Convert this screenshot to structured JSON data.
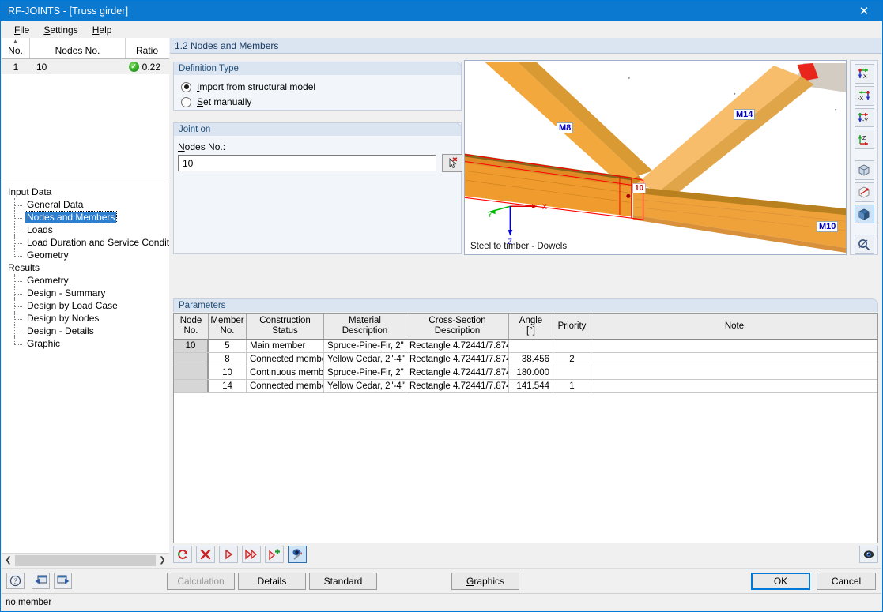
{
  "window": {
    "title": "RF-JOINTS - [Truss girder]",
    "close_icon": "close-icon"
  },
  "menu": {
    "items": [
      {
        "label": "File",
        "accel": "F"
      },
      {
        "label": "Settings",
        "accel": "S"
      },
      {
        "label": "Help",
        "accel": "H"
      }
    ]
  },
  "nodes_list": {
    "columns": [
      "No.",
      "Nodes No.",
      "Ratio"
    ],
    "rows": [
      {
        "no": "1",
        "nodes_no": "10",
        "ratio": "0.22",
        "status_icon": "check-circle-icon"
      }
    ]
  },
  "navigator": {
    "sections": [
      {
        "label": "Input Data",
        "items": [
          {
            "label": "General Data",
            "selected": false
          },
          {
            "label": "Nodes and Members",
            "selected": true
          },
          {
            "label": "Loads",
            "selected": false
          },
          {
            "label": "Load Duration and Service Conditions",
            "selected": false
          },
          {
            "label": "Geometry",
            "selected": false
          }
        ]
      },
      {
        "label": "Results",
        "items": [
          {
            "label": "Geometry",
            "selected": false
          },
          {
            "label": "Design - Summary",
            "selected": false
          },
          {
            "label": "Design by Load Case",
            "selected": false
          },
          {
            "label": "Design by Nodes",
            "selected": false
          },
          {
            "label": "Design - Details",
            "selected": false
          },
          {
            "label": "Graphic",
            "selected": false
          }
        ]
      }
    ]
  },
  "panel": {
    "title": "1.2 Nodes and Members"
  },
  "definition_type": {
    "caption": "Definition Type",
    "options": [
      {
        "label": "Import from structural model",
        "selected": true
      },
      {
        "label": "Set manually",
        "selected": false
      }
    ]
  },
  "joint_on": {
    "caption": "Joint on",
    "field_label": "Nodes No.:",
    "value": "10",
    "placeholder": "",
    "pick_button_icon": "pick-cursor-icon"
  },
  "viewport": {
    "caption": "Steel to timber - Dowels",
    "member_labels": [
      "M8",
      "M14",
      "M10"
    ],
    "node_label": "10",
    "axes": {
      "x": "X",
      "y": "Y",
      "z": "Z"
    },
    "colors": {
      "timber": "#f2a83c",
      "timber_dark": "#c87f1e",
      "timber_light": "#f8c887",
      "steel": "#d3ccc2",
      "highlight": "#e8261b",
      "selection": "#ff0000"
    }
  },
  "view_toolbar": {
    "buttons": [
      {
        "name": "view-x-icon",
        "label": "X",
        "selected": false
      },
      {
        "name": "view-minus-x-icon",
        "label": "-X",
        "selected": false
      },
      {
        "name": "view-minus-y-icon",
        "label": "-Y",
        "selected": false
      },
      {
        "name": "view-z-icon",
        "label": "Z",
        "selected": false
      },
      {
        "name": "isometric-view-icon",
        "label": "",
        "selected": false
      },
      {
        "name": "rotate-view-icon",
        "label": "",
        "selected": false
      },
      {
        "name": "rendering-mode-icon",
        "label": "",
        "selected": true
      },
      {
        "name": "zoom-view-icon",
        "label": "",
        "selected": false
      }
    ]
  },
  "parameters": {
    "caption": "Parameters",
    "columns": [
      {
        "line1": "Node",
        "line2": "No."
      },
      {
        "line1": "Member",
        "line2": "No."
      },
      {
        "line1": "Construction",
        "line2": "Status"
      },
      {
        "line1": "Material",
        "line2": "Description"
      },
      {
        "line1": "Cross-Section",
        "line2": "Description"
      },
      {
        "line1": "Angle",
        "line2": "[°]"
      },
      {
        "line1": "",
        "line2": "Priority"
      },
      {
        "line1": "",
        "line2": "Note"
      }
    ],
    "rows": [
      {
        "node_no": "10",
        "member_no": "5",
        "status": "Main member",
        "material": "Spruce-Pine-Fir, 2\"",
        "cross_section": "Rectangle 4.72441/7.874",
        "angle": "",
        "priority": "",
        "note": ""
      },
      {
        "node_no": "",
        "member_no": "8",
        "status": "Connected member",
        "material": "Yellow Cedar, 2\"-4\"",
        "cross_section": "Rectangle 4.72441/7.874",
        "angle": "38.456",
        "priority": "2",
        "note": ""
      },
      {
        "node_no": "",
        "member_no": "10",
        "status": "Continuous member",
        "material": "Spruce-Pine-Fir, 2\"",
        "cross_section": "Rectangle 4.72441/7.874",
        "angle": "180.000",
        "priority": "",
        "note": ""
      },
      {
        "node_no": "",
        "member_no": "14",
        "status": "Connected member",
        "material": "Yellow Cedar, 2\"-4\"",
        "cross_section": "Rectangle 4.72441/7.874",
        "angle": "141.544",
        "priority": "1",
        "note": ""
      }
    ]
  },
  "table_toolbar": {
    "buttons": [
      {
        "name": "refresh-icon",
        "selected": false
      },
      {
        "name": "delete-icon",
        "selected": false
      },
      {
        "name": "apply-icon",
        "selected": false
      },
      {
        "name": "apply-all-icon",
        "selected": false
      },
      {
        "name": "add-row-icon",
        "selected": false
      },
      {
        "name": "edit-settings-icon",
        "selected": true
      }
    ],
    "right_button": {
      "name": "visibility-icon"
    }
  },
  "footer": {
    "icons": [
      {
        "name": "help-icon"
      },
      {
        "name": "previous-panel-icon"
      },
      {
        "name": "next-panel-icon"
      }
    ],
    "buttons": [
      {
        "label": "Calculation",
        "accel": "",
        "disabled": true,
        "primary": false,
        "name": "calculation-button"
      },
      {
        "label": "Details",
        "accel": "",
        "disabled": false,
        "primary": false,
        "name": "details-button"
      },
      {
        "label": "Standard",
        "accel": "",
        "disabled": false,
        "primary": false,
        "name": "standard-button"
      },
      {
        "label": "Graphics",
        "accel": "G",
        "disabled": false,
        "primary": false,
        "name": "graphics-button"
      }
    ],
    "ok_label": "OK",
    "cancel_label": "Cancel"
  },
  "status": {
    "message": "no member"
  }
}
